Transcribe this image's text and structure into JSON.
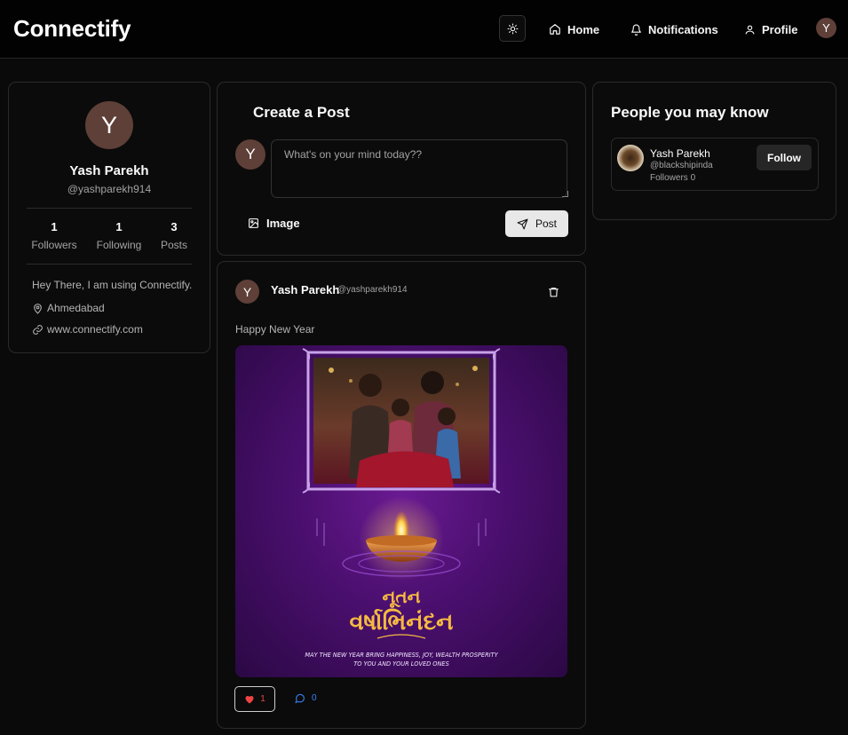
{
  "app": {
    "brand": "Connectify"
  },
  "nav": {
    "home": "Home",
    "notifications": "Notifications",
    "profile": "Profile",
    "avatar_initial": "Y"
  },
  "profile": {
    "avatar_initial": "Y",
    "name": "Yash Parekh",
    "handle": "@yashparekh914",
    "stats": [
      {
        "value": "1",
        "label": "Followers"
      },
      {
        "value": "1",
        "label": "Following"
      },
      {
        "value": "3",
        "label": "Posts"
      }
    ],
    "bio": "Hey There, I am using Connectify.",
    "location": "Ahmedabad",
    "website": "www.connectify.com"
  },
  "create_post": {
    "title": "Create a Post",
    "avatar_initial": "Y",
    "placeholder": "What's on your mind today??",
    "image_label": "Image",
    "post_label": "Post"
  },
  "post": {
    "avatar_initial": "Y",
    "author": "Yash Parekh",
    "handle": "@yashparekh914",
    "text": "Happy New Year",
    "image": {
      "title_line1": "નૂતન",
      "title_line2": "વર્ષાભિનંદન",
      "tagline_line1": "MAY THE NEW YEAR BRING HAPPINESS, JOY, WEALTH PROSPERITY",
      "tagline_line2": "TO YOU AND YOUR LOVED ONES"
    },
    "likes": "1",
    "comments": "0"
  },
  "suggestions": {
    "title": "People you may know",
    "users": [
      {
        "name": "Yash Parekh",
        "handle": "@blackshipinda",
        "followers": "Followers 0",
        "follow_label": "Follow"
      }
    ]
  }
}
